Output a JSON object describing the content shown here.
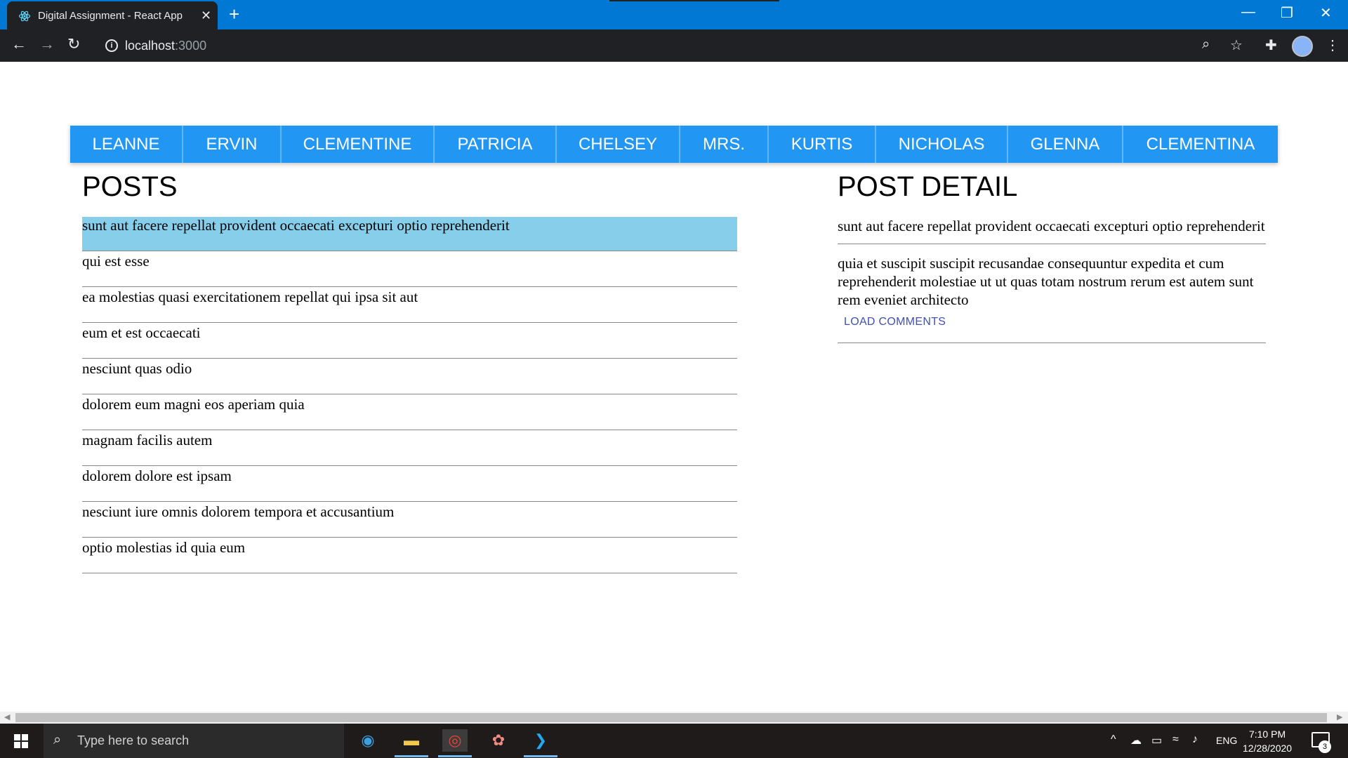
{
  "browser": {
    "tab_title": "Digital Assignment - React App",
    "url_host": "localhost",
    "url_port": ":3000"
  },
  "users": [
    "LEANNE",
    "ERVIN",
    "CLEMENTINE",
    "PATRICIA",
    "CHELSEY",
    "MRS.",
    "KURTIS",
    "NICHOLAS",
    "GLENNA",
    "CLEMENTINA"
  ],
  "posts": {
    "heading": "POSTS",
    "items": [
      "sunt aut facere repellat provident occaecati excepturi optio reprehenderit",
      "qui est esse",
      "ea molestias quasi exercitationem repellat qui ipsa sit aut",
      "eum et est occaecati",
      "nesciunt quas odio",
      "dolorem eum magni eos aperiam quia",
      "magnam facilis autem",
      "dolorem dolore est ipsam",
      "nesciunt iure omnis dolorem tempora et accusantium",
      "optio molestias id quia eum"
    ],
    "selected_index": 0
  },
  "detail": {
    "heading": "POST DETAIL",
    "title": "sunt aut facere repellat provident occaecati excepturi optio reprehenderit",
    "body": "quia et suscipit suscipit recusandae consequuntur expedita et cum reprehenderit molestiae ut ut quas totam nostrum rerum est autem sunt rem eveniet architecto",
    "load_comments_label": "LOAD COMMENTS"
  },
  "taskbar": {
    "search_placeholder": "Type here to search",
    "language": "ENG",
    "time": "7:10 PM",
    "date": "12/28/2020",
    "notification_count": "3"
  },
  "colors": {
    "accent": "#2196f3",
    "selected_row": "#87ceeb",
    "link": "#3f51b5"
  }
}
